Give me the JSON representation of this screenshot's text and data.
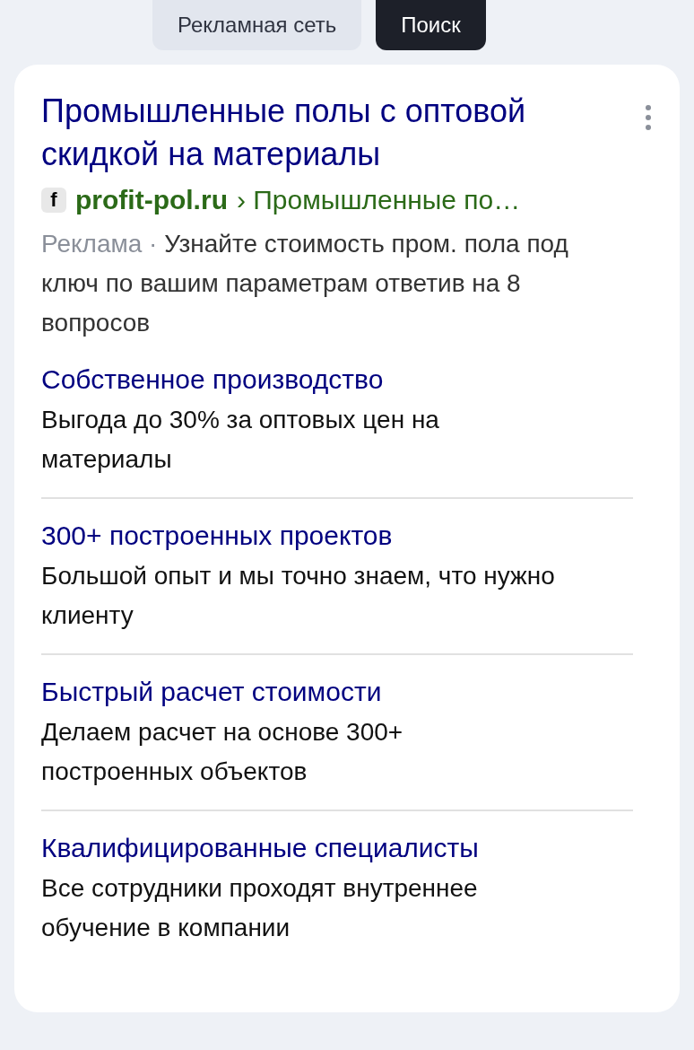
{
  "tabs": [
    {
      "label": "Рекламная сеть",
      "selected": false
    },
    {
      "label": "Поиск",
      "selected": true
    }
  ],
  "ad": {
    "title": "Промышленные полы с оптовой скидкой на материалы",
    "favicon": "f",
    "domain": "profit-pol.ru",
    "path": "› Промышленные по…",
    "ad_label": "Реклама ·",
    "description": "Узнайте стоимость пром. пола под ключ по вашим параметрам ответив на 8 вопросов",
    "sitelinks": [
      {
        "title": "Собственное производство",
        "description": "Выгода до 30% за оптовых цен на материалы"
      },
      {
        "title": "300+ построенных проектов",
        "description": "Большой опыт и мы точно знаем, что нужно клиенту"
      },
      {
        "title": "Быстрый расчет стоимости",
        "description": "Делаем расчет на основе 300+ построенных объектов"
      },
      {
        "title": "Квалифицированные специалисты",
        "description": "Все сотрудники проходят внутреннее обучение в компании"
      }
    ]
  }
}
